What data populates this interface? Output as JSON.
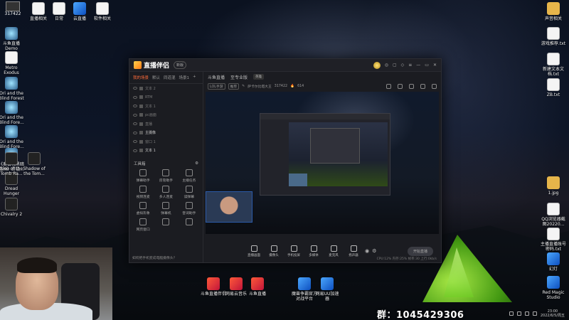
{
  "desktop": {
    "top_left": {
      "label": "317422"
    },
    "top_icons": [
      {
        "label": "直播相关",
        "icon": "folder-icon",
        "x_hint": "doc"
      },
      {
        "label": "日常",
        "icon": "folder-icon"
      },
      {
        "label": "云直播",
        "icon": "cloud-icon"
      },
      {
        "label": "软件相关",
        "icon": "app-icon"
      }
    ],
    "left_icons": [
      {
        "label": "斗鱼直播\nDemo"
      },
      {
        "label": "Metro\nExodus"
      },
      {
        "label": "Ori and the\nBlind Forest"
      },
      {
        "label": "Ori and the\nBlind Fore..."
      },
      {
        "label": "Ori and the\nBlind Fore..."
      },
      {
        "label": "《奥日和黑暗\n森林》终极..."
      },
      {
        "label": "Rise of the\nTomb Ra..."
      },
      {
        "label": "Shadow of\nthe Tom..."
      },
      {
        "label": "Dread\nHunger"
      },
      {
        "label": "Chivalry 2"
      }
    ],
    "right_icons": [
      {
        "label": "声音相关"
      },
      {
        "label": "游戏推荐.txt"
      },
      {
        "label": "新建文本文\n档.txt"
      },
      {
        "label": "ZB.txt"
      },
      {
        "label": "1.jpg"
      },
      {
        "label": "QQ浏览器截\n图20220..."
      },
      {
        "label": "主播直播账号\n密码.txt"
      },
      {
        "label": "幻灯"
      },
      {
        "label": "Red Magic\nStudio"
      }
    ],
    "taskbar_apps": [
      {
        "label": "斗鱼直播伴侣"
      },
      {
        "label": "网易云音乐"
      },
      {
        "label": "斗鱼直播"
      },
      {
        "label": "魔兽争霸官方\n对战平台"
      },
      {
        "label": "网易UU加速\n器"
      }
    ],
    "group_text": "群：1045429306",
    "clock": {
      "time": "23:00",
      "date": "2022/6/5/周五"
    }
  },
  "app": {
    "title": "直播伴侣",
    "version": "新版",
    "left_tabs": [
      "我的场景",
      "默认",
      "同道混",
      "场景1"
    ],
    "sources": [
      "文本 2",
      "RTM",
      "文本 1",
      "pc画面",
      "直播",
      "主摄像",
      "窗口 1",
      "文本 1"
    ],
    "tools_header": "工具箱",
    "tools": [
      "弹幕助手",
      "房管助手",
      "主播任务",
      "视频连麦",
      "多人连麦",
      "读弹幕",
      "虚拟形象",
      "弹幕机",
      "音词助手",
      "网页窗口",
      "",
      ""
    ],
    "hint": "如何把手机变成电脑摄像头？",
    "main_tabs": [
      "斗鱼直播",
      "至专业版",
      "英雄"
    ],
    "room_info": {
      "category": "LOL手游",
      "tag": "推荐",
      "title": "萨卡尔比塔大王",
      "room": "317422",
      "hot": "614"
    },
    "controls": [
      "直播画面",
      "摄像头",
      "手机投屏",
      "多媒体",
      "麦克风",
      "扬声器"
    ],
    "golive_label": "开始直播",
    "status": "CPU:12% 内存:25%  帧率:30  上行:0kb/s"
  }
}
